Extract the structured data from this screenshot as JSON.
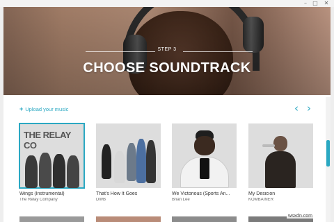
{
  "window": {
    "minimize_glyph": "–",
    "maximize_glyph": "□",
    "close_glyph": "✕"
  },
  "hero": {
    "step_label": "STEP 3",
    "title": "CHOOSE SOUNDTRACK"
  },
  "toolbar": {
    "upload_icon": "+",
    "upload_label": "Upload your music",
    "prev_glyph": "‹",
    "next_glyph": "›"
  },
  "tracks": [
    {
      "song": "Wings (Instrumental)",
      "artist": "The Relay Company",
      "art_text": "THE RELAY CO",
      "selected": true
    },
    {
      "song": "That's How It Goes",
      "artist": "DWB",
      "selected": false
    },
    {
      "song": "We Victorious (Sports An...",
      "artist": "Brian Lee",
      "selected": false
    },
    {
      "song": "My Desicion",
      "artist": "KOMBAINER",
      "selected": false
    }
  ],
  "watermark": "wsxdn.com",
  "colors": {
    "accent": "#2aa8c2"
  }
}
